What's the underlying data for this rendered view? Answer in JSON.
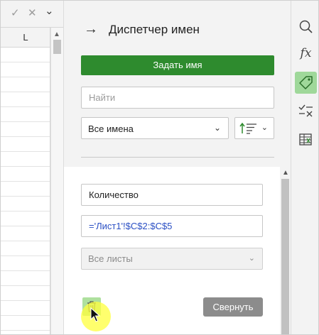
{
  "sheet": {
    "column_header": "L",
    "confirm_glyph": "✓",
    "cancel_glyph": "✕",
    "expand_glyph": "⌄",
    "scroll_up_glyph": "▲"
  },
  "panel": {
    "back_glyph": "→",
    "title": "Диспетчер имен",
    "define_button": "Задать имя",
    "search_placeholder": "Найти",
    "filter_value": "Все имена",
    "filter_chevron": "⌄",
    "sort_chevron": "⌄",
    "scroll_up_glyph": "▲"
  },
  "edit": {
    "name_value": "Количество",
    "reference_value": "='Лист1'!$C$2:$C$5",
    "scope_value": "Все листы",
    "scope_chevron": "⌄",
    "collapse_button": "Свернуть"
  },
  "toolbar": {
    "function_glyph": "fx",
    "items": [
      "search-icon",
      "function-icon",
      "tag-icon",
      "check-clear-icon",
      "table-icon"
    ],
    "active_item": "tag-icon"
  },
  "colors": {
    "accent_green": "#2e8b2e",
    "active_tool_bg": "#9fd89a",
    "reference_text": "#2a4fc4",
    "cursor_highlight": "#ffff3c"
  }
}
